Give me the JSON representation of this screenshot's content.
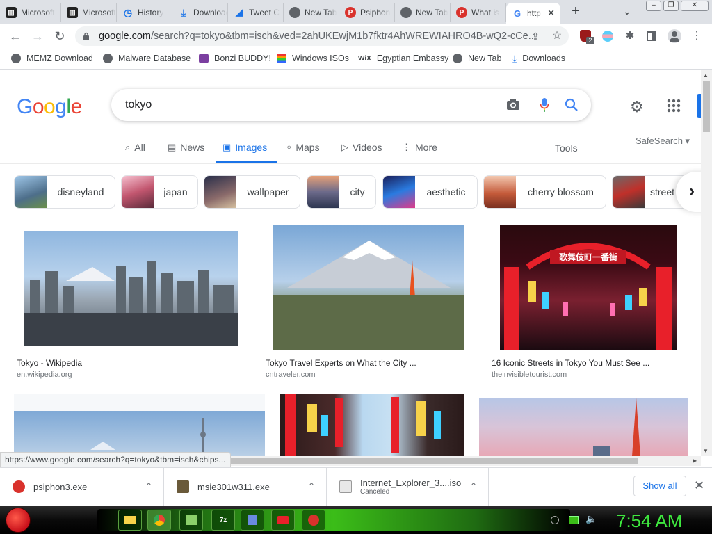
{
  "tabs": [
    {
      "title": "Microsoft",
      "icon": "museum-icon"
    },
    {
      "title": "Microsoft",
      "icon": "museum-icon"
    },
    {
      "title": "History",
      "icon": "history-icon"
    },
    {
      "title": "Downloads",
      "icon": "download-icon"
    },
    {
      "title": "Tweet C",
      "icon": "chart-icon"
    },
    {
      "title": "New Tab",
      "icon": "globe-icon"
    },
    {
      "title": "Psiphon",
      "icon": "psiphon-icon"
    },
    {
      "title": "New Tab",
      "icon": "globe-icon"
    },
    {
      "title": "What is",
      "icon": "psiphon-icon"
    },
    {
      "title": "http",
      "icon": "google-icon"
    }
  ],
  "address": {
    "url_host": "google.com",
    "url_rest": "/search?q=tokyo&tbm=isch&ved=2ahUKEwjM1b7fktr4AhWREWIAHRO4B-wQ2-cCe..."
  },
  "extension_badge": "2",
  "bookmarks": [
    {
      "label": "MEMZ Download"
    },
    {
      "label": "Malware Database"
    },
    {
      "label": "Bonzi BUDDY!"
    },
    {
      "label": "Windows ISOs"
    },
    {
      "label": "Egyptian Embassy"
    },
    {
      "label": "New Tab"
    },
    {
      "label": "Downloads"
    }
  ],
  "google": {
    "logo": {
      "g1": "G",
      "o1": "o",
      "o2": "o",
      "g2": "g",
      "l": "l",
      "e": "e"
    },
    "query": "tokyo",
    "nav": [
      "All",
      "News",
      "Images",
      "Maps",
      "Videos",
      "More"
    ],
    "tools": "Tools",
    "safesearch": "SafeSearch ▾",
    "chips": [
      "disneyland",
      "japan",
      "wallpaper",
      "city",
      "aesthetic",
      "cherry blossom",
      "street"
    ],
    "results": [
      {
        "title": "Tokyo - Wikipedia",
        "source": "en.wikipedia.org"
      },
      {
        "title": "Tokyo Travel Experts on What the City ...",
        "source": "cntraveler.com"
      },
      {
        "title": "16 Iconic Streets in Tokyo You Must See ...",
        "source": "theinvisibletourist.com"
      }
    ],
    "sign_text": "歌舞伎町一番街"
  },
  "status_url": "https://www.google.com/search?q=tokyo&tbm=isch&chips...",
  "downloads": [
    {
      "name": "psiphon3.exe",
      "status": ""
    },
    {
      "name": "msie301w311.exe",
      "status": ""
    },
    {
      "name": "Internet_Explorer_3....iso",
      "status": "Canceled"
    }
  ],
  "show_all": "Show all",
  "clock": "7:54 AM",
  "colors": {
    "google_blue": "#4285f4",
    "google_red": "#ea4335",
    "google_yellow": "#fbbc05",
    "google_green": "#34a853",
    "accent": "#1a73e8"
  }
}
